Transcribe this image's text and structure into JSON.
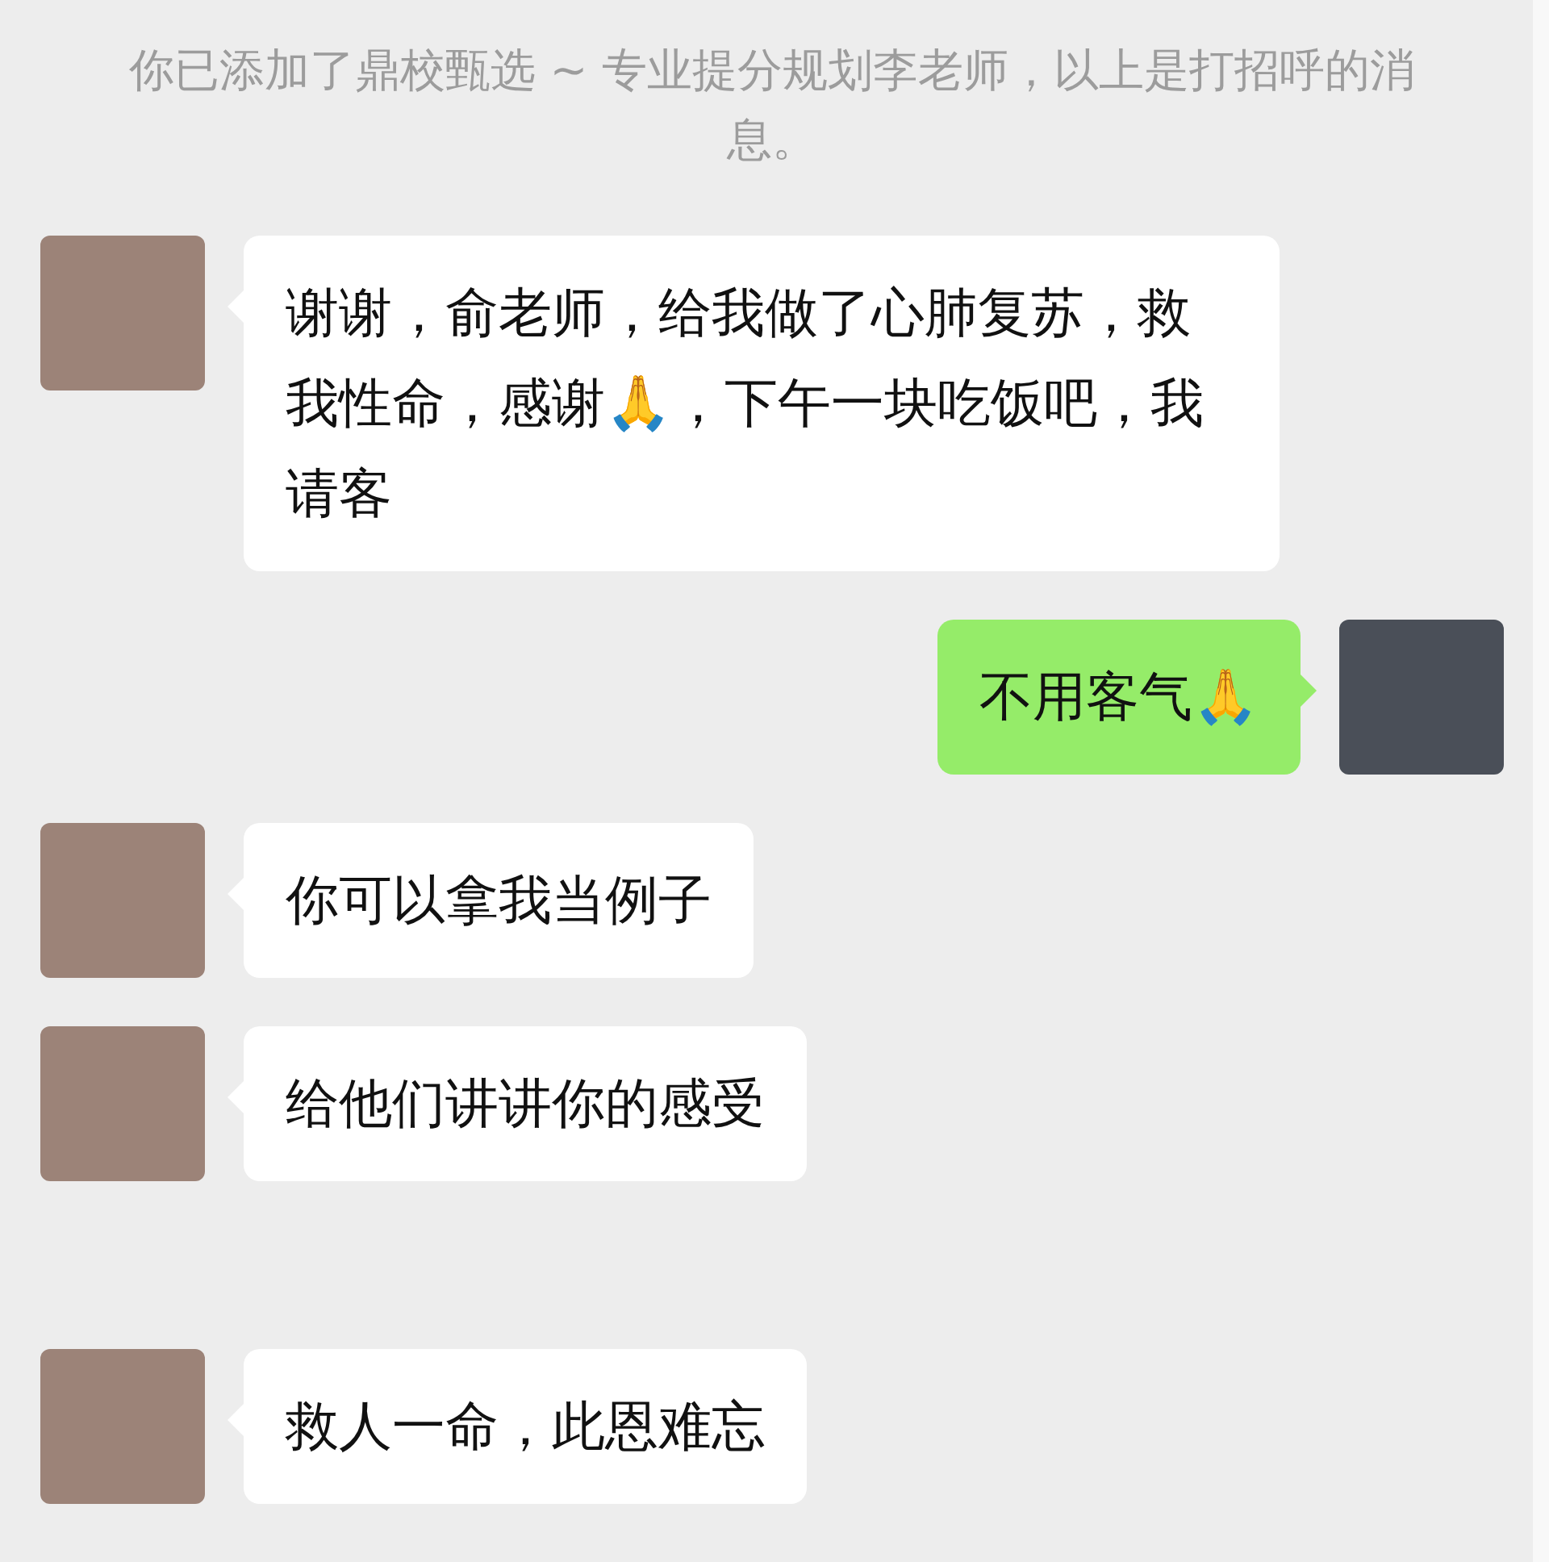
{
  "system_message": "你已添加了鼎校甄选 ~ 专业提分规划李老师，以上是打招呼的消息。",
  "messages": [
    {
      "kind": "incoming",
      "text": "谢谢，俞老师，给我做了心肺复苏，救我性命，感谢🙏，下午一块吃饭吧，我请客"
    },
    {
      "kind": "outgoing",
      "text": "不用客气🙏"
    },
    {
      "kind": "incoming",
      "text": "你可以拿我当例子"
    },
    {
      "kind": "incoming",
      "text": "给他们讲讲你的感受"
    },
    {
      "kind": "incoming",
      "text": "救人一命，此恩难忘"
    }
  ]
}
